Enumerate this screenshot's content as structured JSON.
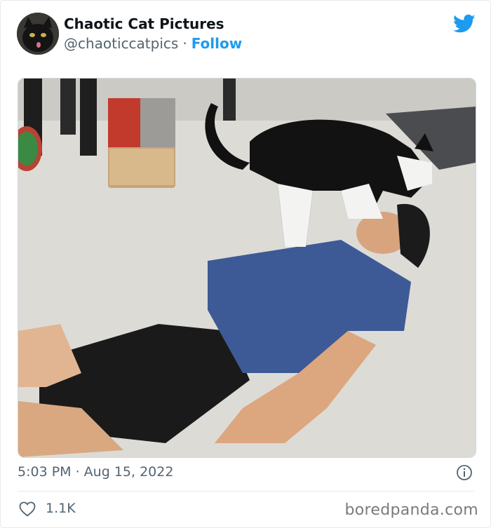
{
  "tweet": {
    "display_name": "Chaotic Cat Pictures",
    "handle": "@chaoticcatpics",
    "separator": "·",
    "follow_label": "Follow",
    "timestamp": "5:03 PM · Aug 15, 2022",
    "likes": "1.1K"
  },
  "watermark": "boredpanda.com",
  "colors": {
    "accent": "#1d9bf0",
    "secondary_text": "#536471",
    "primary_text": "#0f1419"
  },
  "icons": {
    "brand": "twitter-bird-icon",
    "info": "info-icon",
    "like": "heart-icon"
  }
}
